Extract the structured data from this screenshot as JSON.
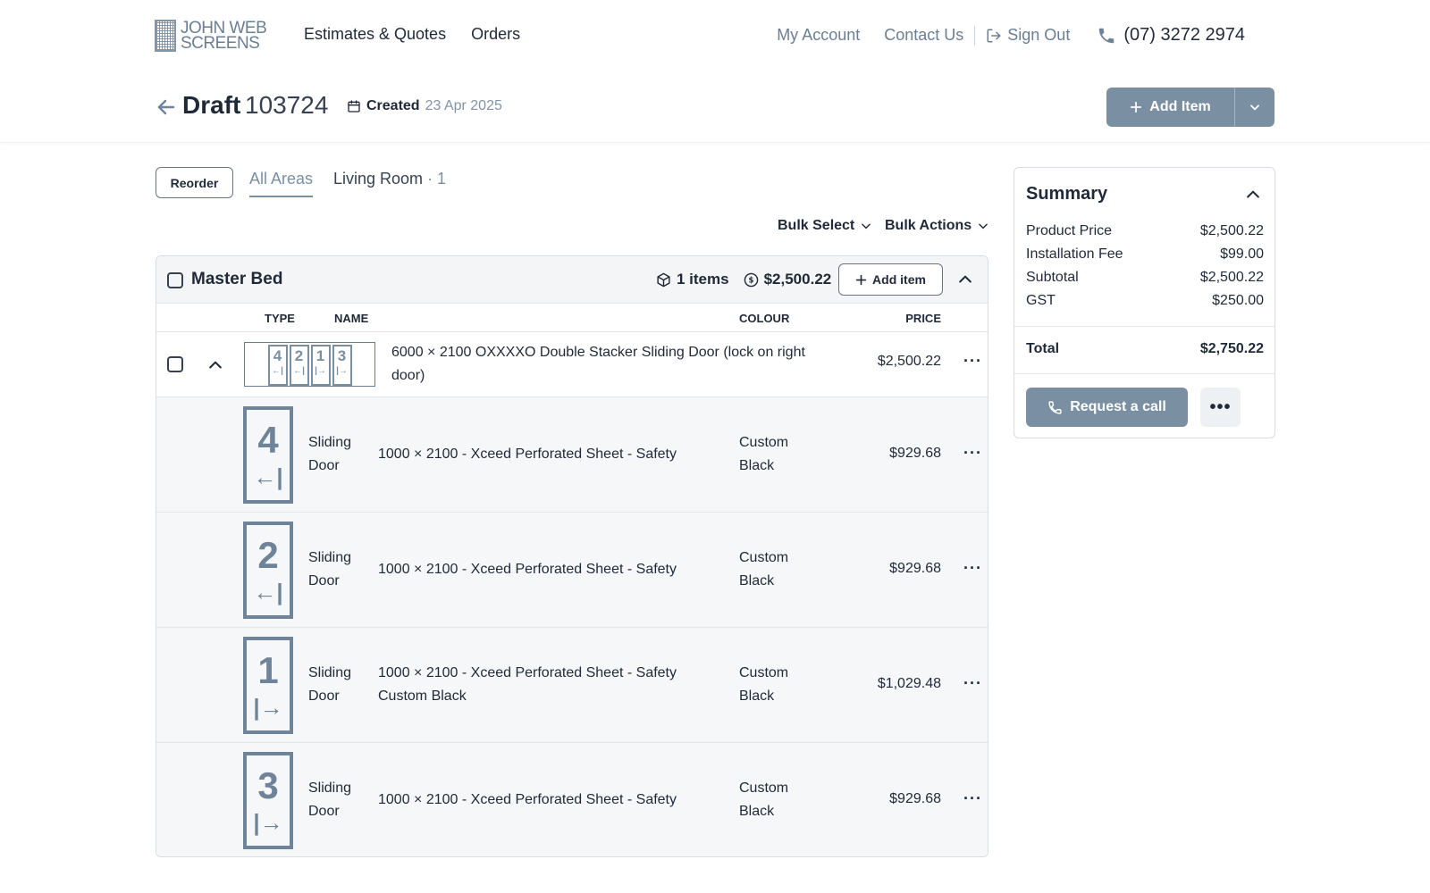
{
  "logo": {
    "line1": "JOHN WEB",
    "line2": "SCREENS"
  },
  "nav": {
    "estimates": "Estimates & Quotes",
    "orders": "Orders",
    "my_account": "My Account",
    "contact": "Contact Us",
    "sign_out": "Sign Out",
    "phone": "(07) 3272 2974"
  },
  "header": {
    "title": "Draft",
    "number": "103724",
    "created_label": "Created",
    "created_date": "23 Apr 2025",
    "add_item": "Add Item"
  },
  "tabs": {
    "reorder": "Reorder",
    "all_areas": "All Areas",
    "living_room": "Living Room",
    "living_room_count": "· 1"
  },
  "bulk": {
    "select": "Bulk Select",
    "actions": "Bulk Actions"
  },
  "group": {
    "title": "Master Bed",
    "items": "1 items",
    "total": "$2,500.22",
    "add_item": "Add item",
    "columns": {
      "type": "TYPE",
      "name": "NAME",
      "colour": "COLOUR",
      "price": "PRICE"
    },
    "main_item": {
      "name_line1": "6000 × 2100 OXXXXO Double Stacker Sliding Door (lock on right",
      "name_line2": "door)",
      "price": "$2,500.22",
      "panels": [
        {
          "num": "4",
          "arrow": "←|"
        },
        {
          "num": "2",
          "arrow": "←|"
        },
        {
          "num": "1",
          "arrow": "|→"
        },
        {
          "num": "3",
          "arrow": "|→"
        }
      ]
    },
    "sub_items": [
      {
        "panel": "4",
        "arrow": "←|",
        "type1": "Sliding",
        "type2": "Door",
        "name1": "1000 × 2100 - Xceed Perforated Sheet - Safety",
        "name2": "",
        "colour1": "Custom",
        "colour2": "Black",
        "price": "$929.68"
      },
      {
        "panel": "2",
        "arrow": "←|",
        "type1": "Sliding",
        "type2": "Door",
        "name1": "1000 × 2100 - Xceed Perforated Sheet - Safety",
        "name2": "",
        "colour1": "Custom",
        "colour2": "Black",
        "price": "$929.68"
      },
      {
        "panel": "1",
        "arrow": "|→",
        "type1": "Sliding",
        "type2": "Door",
        "name1": "1000 × 2100 - Xceed Perforated Sheet - Safety",
        "name2": "Custom Black",
        "colour1": "Custom",
        "colour2": "Black",
        "price": "$1,029.48"
      },
      {
        "panel": "3",
        "arrow": "|→",
        "type1": "Sliding",
        "type2": "Door",
        "name1": "1000 × 2100 - Xceed Perforated Sheet - Safety",
        "name2": "",
        "colour1": "Custom",
        "colour2": "Black",
        "price": "$929.68"
      }
    ]
  },
  "summary": {
    "title": "Summary",
    "product_price_label": "Product Price",
    "product_price": "$2,500.22",
    "installation_label": "Installation Fee",
    "installation": "$99.00",
    "subtotal_label": "Subtotal",
    "subtotal": "$2,500.22",
    "gst_label": "GST",
    "gst": "$250.00",
    "total_label": "Total",
    "total": "$2,750.22",
    "request_call": "Request a call",
    "more": "•••"
  },
  "colors": {
    "accent": "#7b8fa3",
    "text": "#1f2937",
    "muted": "#6b7e93"
  }
}
